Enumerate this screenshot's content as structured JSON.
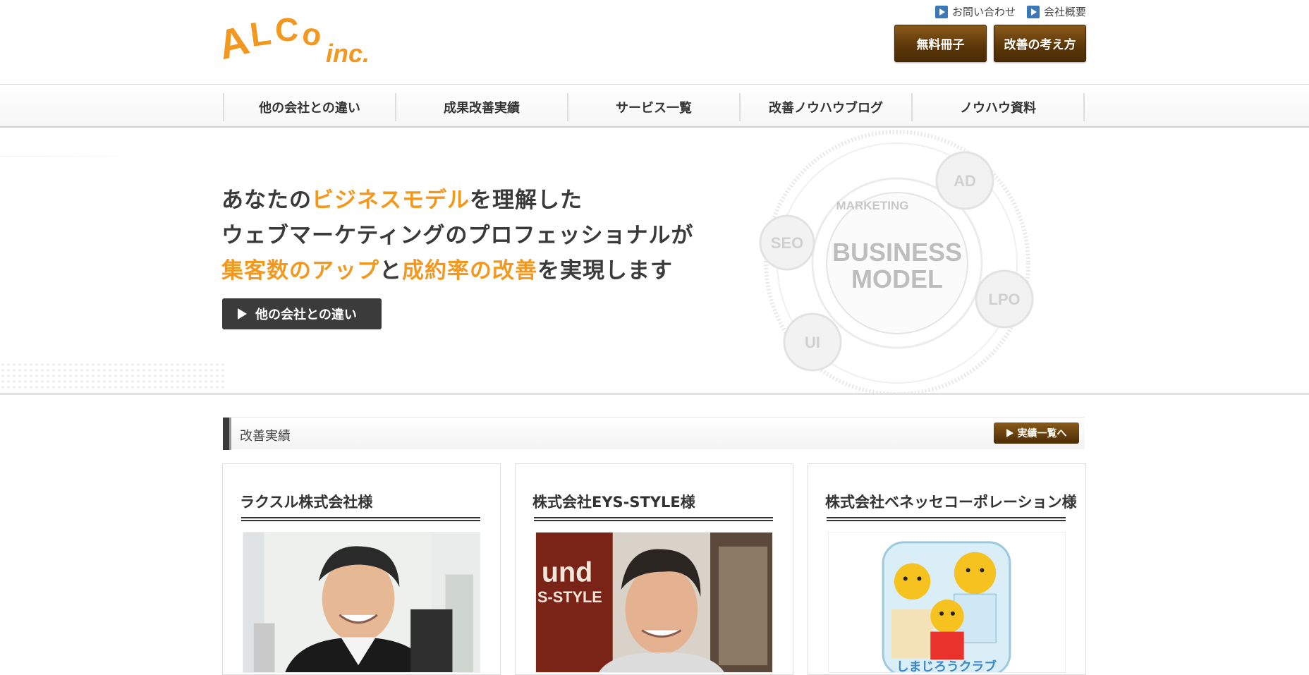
{
  "header": {
    "logo_text": "ALCO inc.",
    "util_links": [
      "お問い合わせ",
      "会社概要"
    ],
    "cta_buttons": [
      "無料冊子",
      "改善の考え方"
    ]
  },
  "nav": {
    "items": [
      "他の会社との違い",
      "成果改善実績",
      "サービス一覧",
      "改善ノウハウブログ",
      "ノウハウ資料"
    ]
  },
  "hero": {
    "line1_a": "あなたの",
    "line1_hl": "ビジネスモデル",
    "line1_b": "を理解した",
    "line2": "ウェブマーケティングのプロフェッショナルが",
    "line3_hl1": "集客数のアップ",
    "line3_a": "と",
    "line3_hl2": "成約率の改善",
    "line3_b": "を実現します",
    "button_label": "他の会社との違い",
    "diagram": {
      "center_line1": "BUSINESS",
      "center_line2": "MODEL",
      "top_label": "MARKETING",
      "nodes": [
        "AD",
        "SEO",
        "LPO",
        "UI"
      ]
    }
  },
  "results": {
    "title": "改善実績",
    "link_label": "実績一覧へ",
    "cards": [
      {
        "title": "ラクスル株式会社様"
      },
      {
        "title": "株式会社EYS-STYLE様",
        "photo_sign": "und",
        "photo_sign2": "S-STYLE"
      },
      {
        "title": "株式会社ベネッセコーポレーション様",
        "logo_text": "しまじろうクラブ"
      }
    ]
  },
  "colors": {
    "accent": "#f2981e",
    "brown_button": "#5a3608",
    "dark_button": "#3b3b3b"
  }
}
